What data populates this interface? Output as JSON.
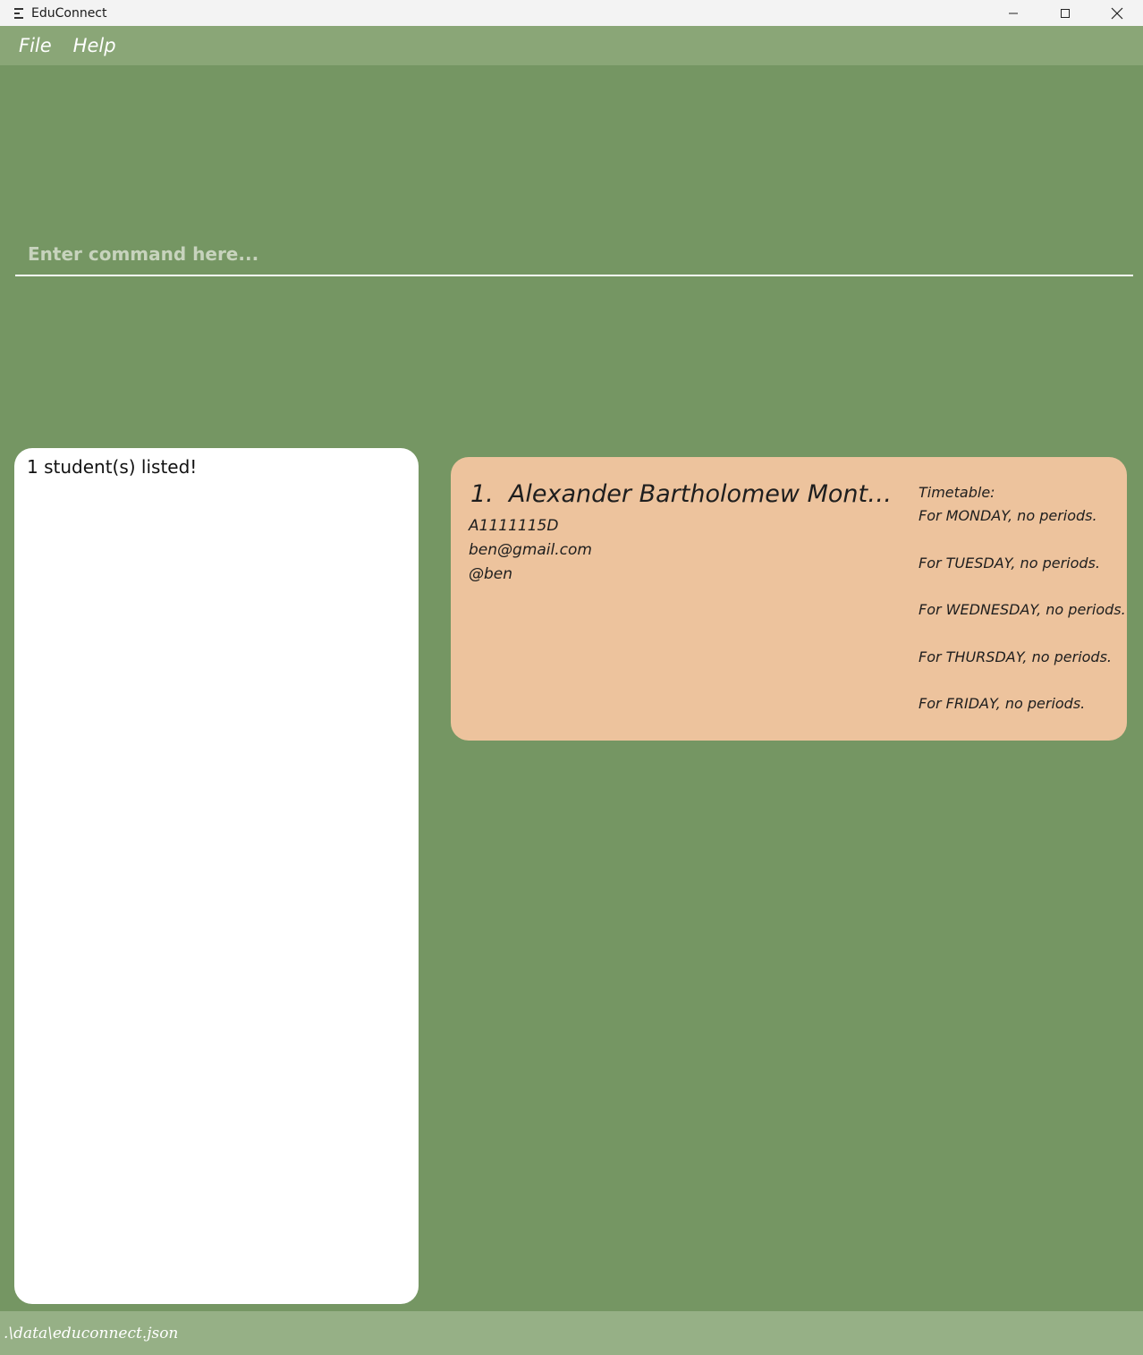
{
  "window": {
    "title": "EduConnect",
    "icons": [
      "app-icon",
      "minimize-icon",
      "maximize-icon",
      "close-icon"
    ]
  },
  "menu": {
    "file": "File",
    "help": "Help"
  },
  "command": {
    "placeholder": "Enter command here...",
    "value": ""
  },
  "result": {
    "message": "1 student(s) listed!"
  },
  "students": [
    {
      "index": "1.",
      "name": "Alexander Bartholomew Montgo...",
      "student_id": "A1111115D",
      "email": "ben@gmail.com",
      "telegram": "@ben",
      "timetable_label": "Timetable:",
      "timetable": [
        "For MONDAY, no periods.",
        "For TUESDAY, no periods.",
        "For WEDNESDAY, no periods.",
        "For THURSDAY, no periods.",
        "For FRIDAY, no periods."
      ]
    }
  ],
  "status": {
    "path": ".\\data\\educonnect.json"
  },
  "colors": {
    "background": "#759663",
    "menubar": "#8aa677",
    "statusbar": "#96b086",
    "card": "#edc39d",
    "result_box": "#ffffff"
  }
}
